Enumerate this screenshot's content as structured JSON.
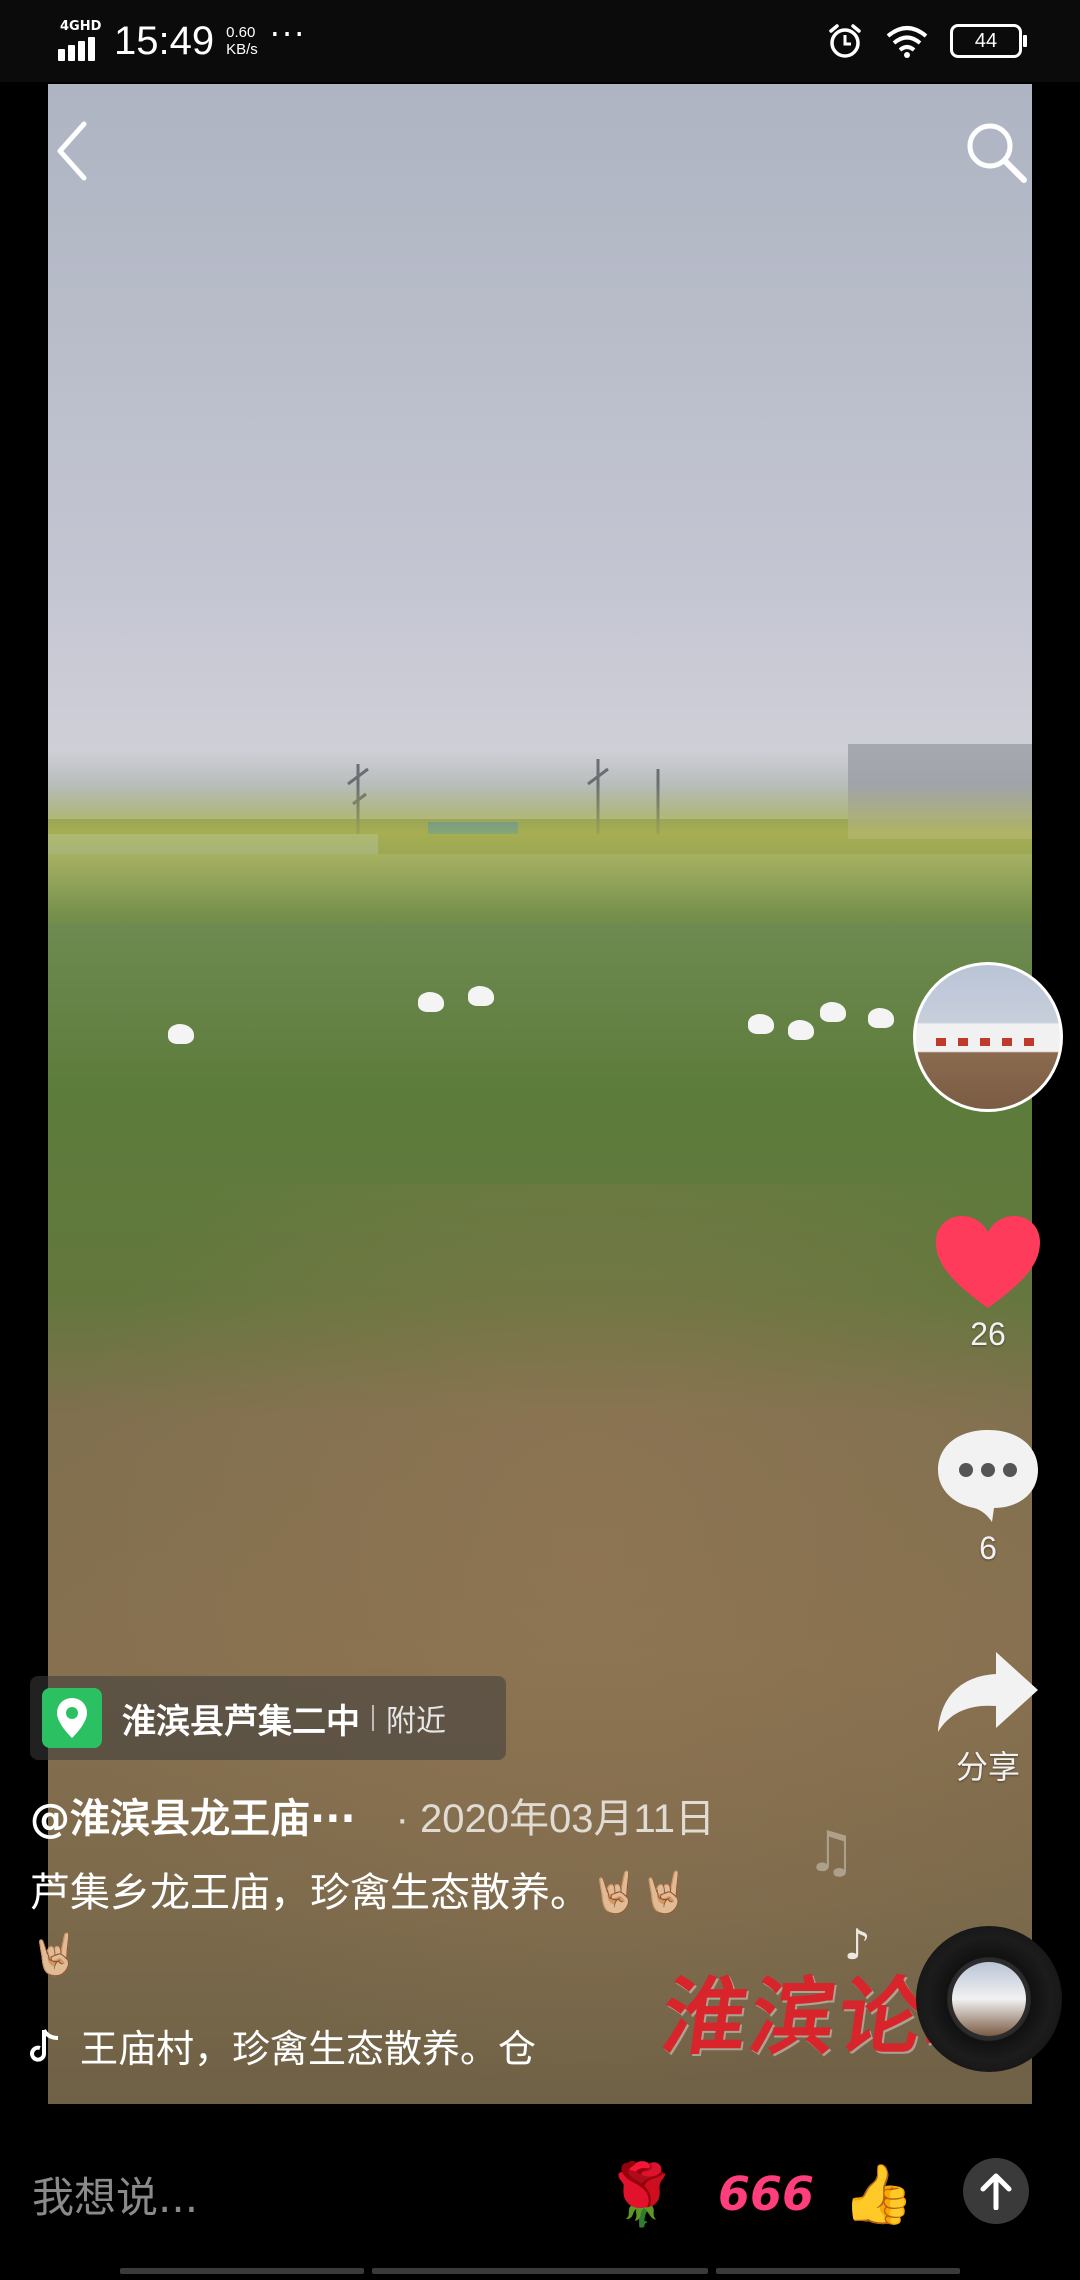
{
  "status_bar": {
    "network": "4GHD",
    "time": "15:49",
    "speed_value": "0.60",
    "speed_unit": "KB/s",
    "more": "···",
    "battery": "44",
    "icons": [
      "alarm-icon",
      "wifi-icon",
      "battery-icon"
    ]
  },
  "top_bar": {
    "back_icon": "chevron-left-icon",
    "search_icon": "search-icon"
  },
  "rail": {
    "likes": "26",
    "comments": "6",
    "share_label": "分享",
    "like_color": "#ff3b5c"
  },
  "location": {
    "name": "淮滨县芦集二中",
    "nearby": "附近"
  },
  "post": {
    "author": "@淮滨县龙王庙···",
    "date": "· 2020年03月11日",
    "caption_line1": "芦集乡龙王庙，珍禽生态散养。🤘🏼🤘🏼",
    "caption_line2": "🤘🏼"
  },
  "music": {
    "title": "王庙村，珍禽生态散养。仓"
  },
  "watermark": "淮滨论坛",
  "comment_bar": {
    "placeholder": "我想说...",
    "quick_emojis": [
      "🌹",
      "666",
      "👍"
    ],
    "send_icon": "arrow-up-icon"
  }
}
